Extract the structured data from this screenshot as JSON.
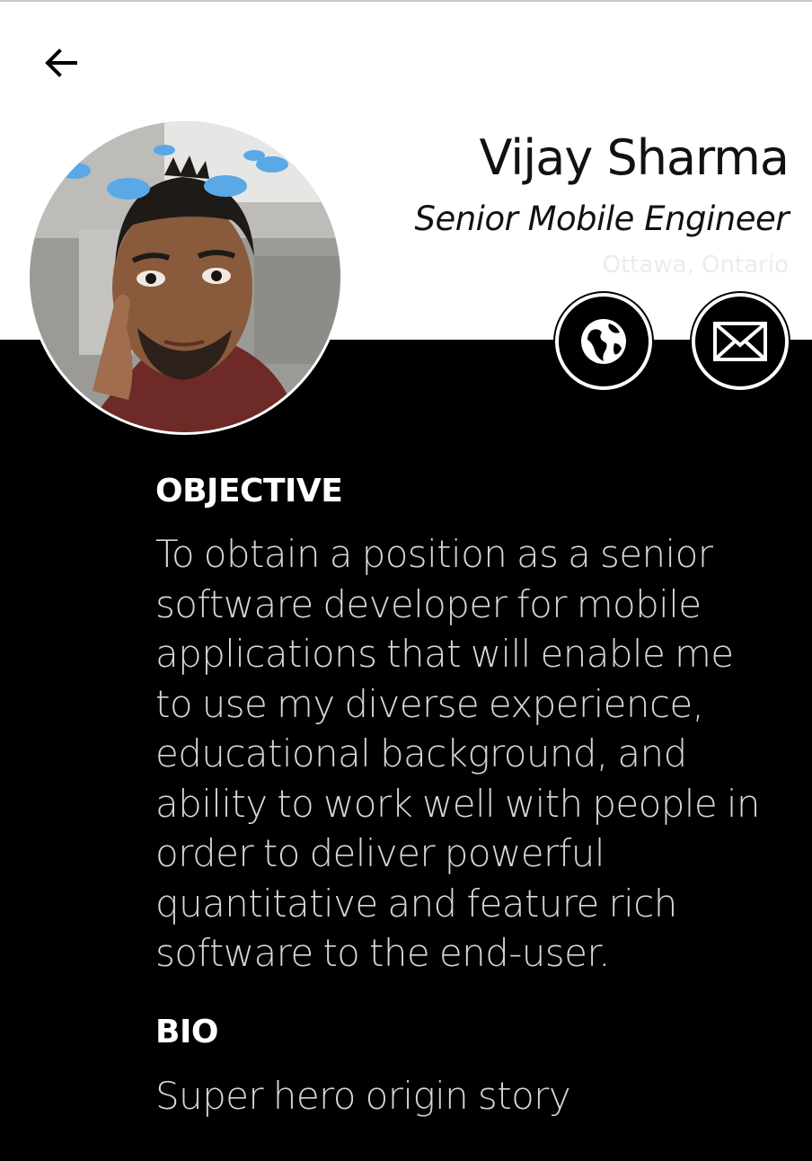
{
  "profile": {
    "name": "Vijay Sharma",
    "title": "Senior Mobile Engineer",
    "location": "Ottawa, Ontario"
  },
  "icons": {
    "back": "arrow-left-icon",
    "website": "globe-icon",
    "email": "envelope-icon"
  },
  "objective": {
    "heading": "OBJECTIVE",
    "text": "To obtain a position as a senior software developer for mobile applications that will enable me to use my diverse experience, educational background, and ability to work well with people in order to deliver powerful quantitative and feature rich software to the end-user."
  },
  "bio": {
    "heading": "BIO",
    "text": "Super hero origin story"
  },
  "colors": {
    "header_background": "#ffffff",
    "content_background": "#000000",
    "heading_text": "#ffffff",
    "body_text": "#d6d6d6",
    "location_text": "#ececec"
  }
}
